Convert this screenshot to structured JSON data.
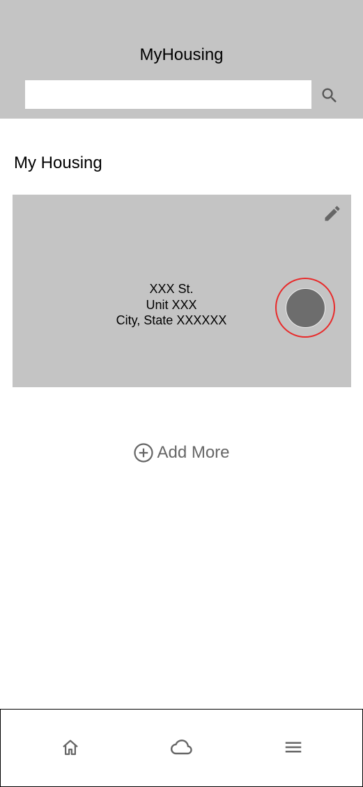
{
  "header": {
    "title": "MyHousing",
    "search": {
      "value": "",
      "placeholder": "",
      "icon": "search-icon"
    }
  },
  "main": {
    "section_title": "My Housing",
    "housing_card": {
      "address_line1": "XXX St.",
      "address_line2": "Unit XXX",
      "address_line3": "City, State XXXXXX",
      "edit_icon": "pencil-icon",
      "toggle_ring_color": "#e82a2a",
      "toggle_dot_color": "#6d6d6d"
    },
    "add_more": {
      "label": "Add More",
      "icon": "plus-circle-icon"
    }
  },
  "bottom_nav": {
    "items": [
      {
        "icon": "home-icon"
      },
      {
        "icon": "cloud-icon"
      },
      {
        "icon": "menu-icon"
      }
    ]
  },
  "colors": {
    "header_bg": "#c4c4c4",
    "card_bg": "#c4c4c4",
    "icon_gray": "#666666"
  }
}
